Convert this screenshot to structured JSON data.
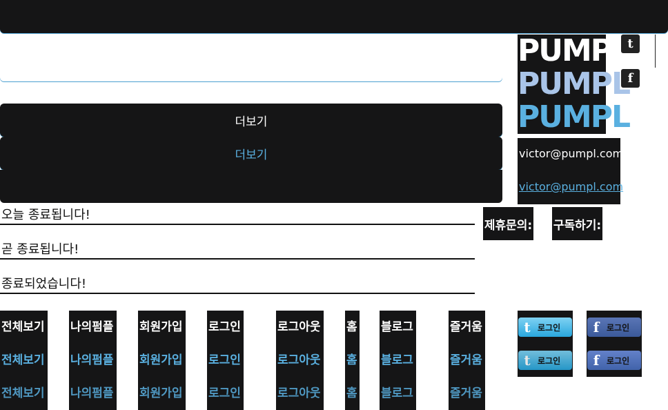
{
  "more_buttons": [
    "더보기",
    "더보기"
  ],
  "logo": {
    "text": "PUMPL",
    "colors": [
      "#ffffff",
      "#a9c4e8",
      "#5ab0e0"
    ]
  },
  "sns": {
    "twitter_glyph": "t",
    "facebook_glyph": "f"
  },
  "emails": [
    "victor@pumpl.com",
    "victor@pumpl.com"
  ],
  "status_lines": [
    "오늘 종료됩니다!",
    "곧 종료됩니다!",
    "종료되었습니다!"
  ],
  "pills": [
    "제휴문의:",
    "구독하기:"
  ],
  "nav": {
    "all": [
      "전체보기",
      "전체보기",
      "전체보기"
    ],
    "mypumpl": [
      "나의펌플",
      "나의펌플",
      "나의펌플"
    ],
    "signup": [
      "회원가입",
      "회원가입",
      "회원가입"
    ],
    "login": [
      "로그인",
      "로그인",
      "로그인"
    ],
    "logout": [
      "로그아웃",
      "로그아웃",
      "로그아웃"
    ],
    "home": [
      "홈",
      "홈",
      "홈"
    ],
    "blog": [
      "블로그",
      "블로그",
      "블로그"
    ],
    "fun": [
      "즐거움",
      "즐거움",
      "즐거움"
    ]
  },
  "social_login": {
    "label": "로그인",
    "twitter_glyph": "t",
    "facebook_glyph": "f"
  },
  "colors": {
    "dark": "#151516",
    "accent": "#5ab0e0"
  }
}
